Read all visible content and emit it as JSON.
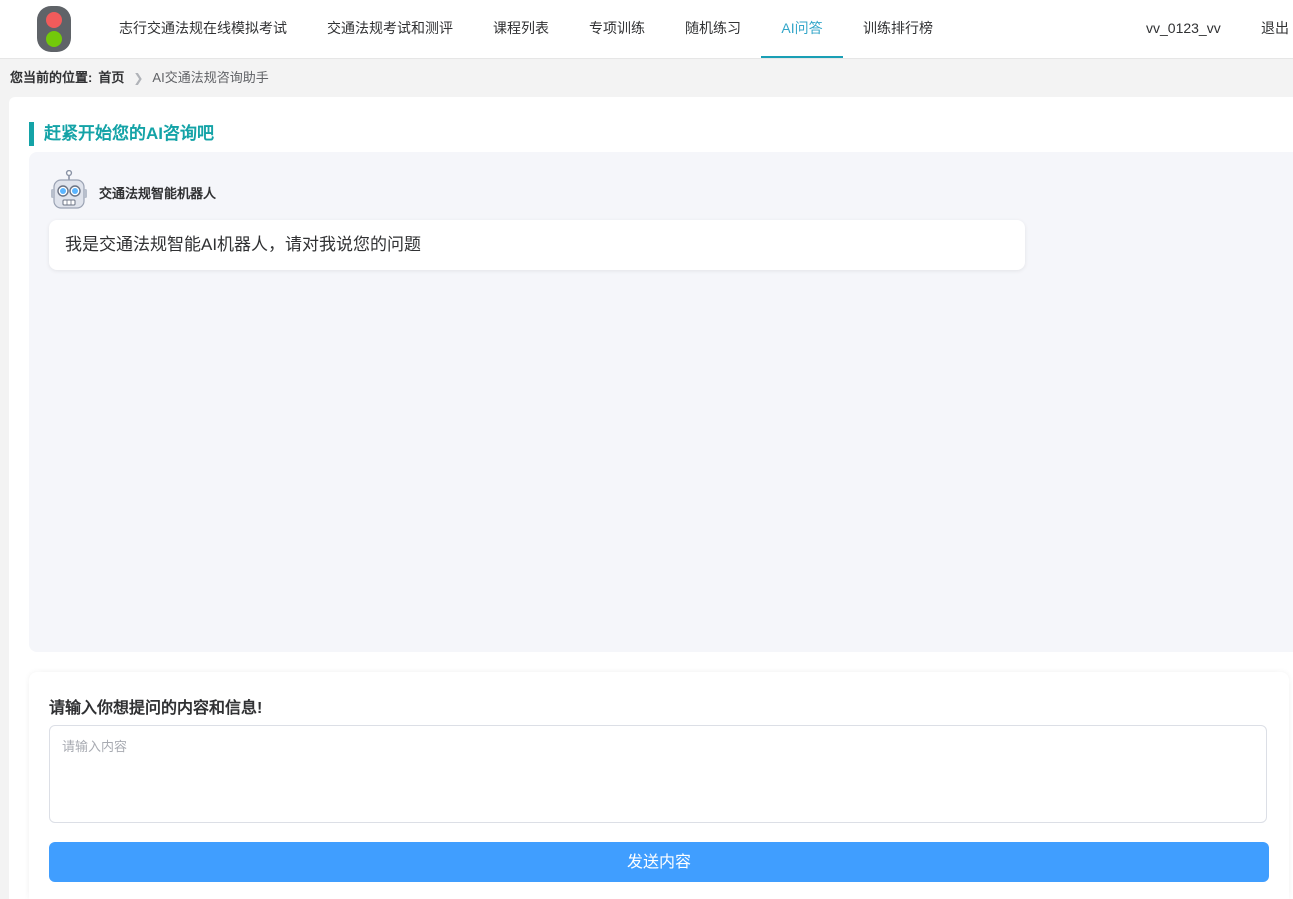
{
  "header": {
    "logo_icon": "traffic-light-icon",
    "nav": [
      {
        "label": "志行交通法规在线模拟考试"
      },
      {
        "label": "交通法规考试和测评"
      },
      {
        "label": "课程列表"
      },
      {
        "label": "专项训练"
      },
      {
        "label": "随机练习"
      },
      {
        "label": "AI问答",
        "active": true
      },
      {
        "label": "训练排行榜"
      }
    ],
    "username": "vv_0123_vv",
    "logout_label": "退出"
  },
  "breadcrumb": {
    "label": "您当前的位置:",
    "home": "首页",
    "current": "AI交通法规咨询助手"
  },
  "chat": {
    "section_title": "赶紧开始您的AI咨询吧",
    "bot_icon": "robot-icon",
    "bot_name": "交通法规智能机器人",
    "messages": [
      {
        "text": "我是交通法规智能AI机器人，请对我说您的问题"
      }
    ]
  },
  "input": {
    "title": "请输入你想提问的内容和信息!",
    "placeholder": "请输入内容",
    "value": "",
    "send_label": "发送内容"
  },
  "colors": {
    "accent_teal": "#14a3a7",
    "primary_blue": "#409eff",
    "nav_active": "#33a6c9"
  }
}
